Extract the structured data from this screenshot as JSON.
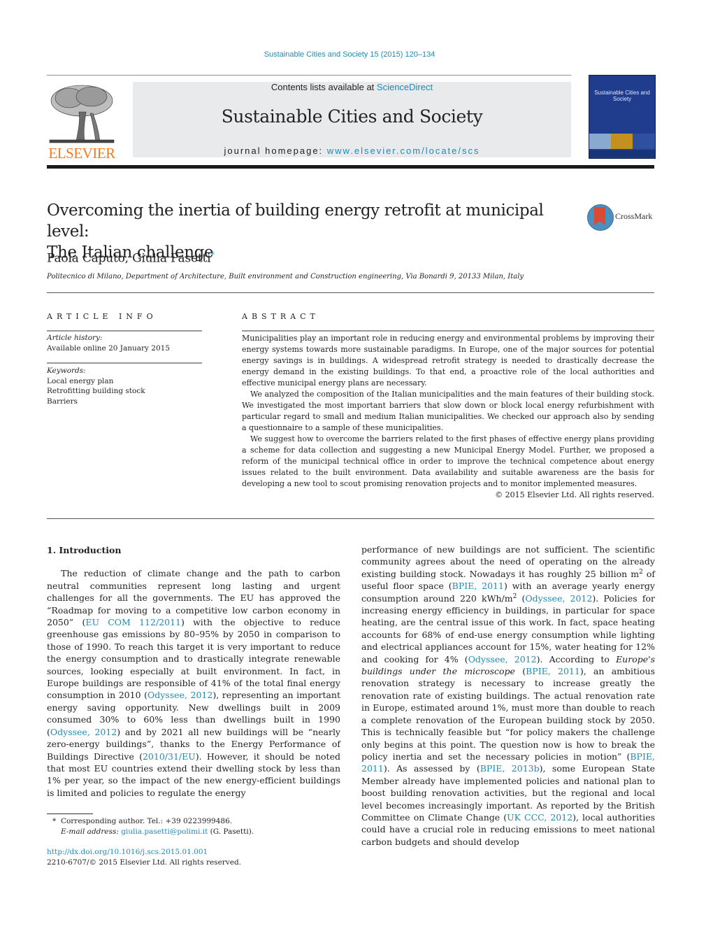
{
  "header": {
    "journal_reference": "Sustainable Cities and Society 15 (2015) 120–134",
    "contents_prefix": "Contents lists available at ",
    "contents_link": "ScienceDirect",
    "journal_title": "Sustainable Cities and Society",
    "homepage_prefix": "journal homepage: ",
    "homepage_url": "www.elsevier.com/locate/scs",
    "publisher_logo_text": "ELSEVIER",
    "cover_title": "Sustainable Cities and Society",
    "logo_icon": "elsevier-tree-icon",
    "cover_icon": "journal-cover-icon"
  },
  "article": {
    "title_line1": "Overcoming the inertia of building energy retrofit at municipal level:",
    "title_line2": "The Italian challenge",
    "crossmark_label": "CrossMark",
    "authors": "Paola Caputo, Giulia Pasetti",
    "corresponding_marker": "*",
    "affiliation": "Politecnico di Milano, Department of Architecture, Built environment and Construction engineering, Via Bonardi 9, 20133 Milan, Italy"
  },
  "article_info": {
    "heading": "ARTICLE INFO",
    "history_label": "Article history:",
    "history_value": "Available online 20 January 2015",
    "keywords_label": "Keywords:",
    "keywords": [
      "Local energy plan",
      "Retrofitting building stock",
      "Barriers"
    ]
  },
  "abstract": {
    "heading": "ABSTRACT",
    "paragraphs": [
      "Municipalities play an important role in reducing energy and environmental problems by improving their energy systems towards more sustainable paradigms. In Europe, one of the major sources for potential energy savings is in buildings. A widespread retrofit strategy is needed to drastically decrease the energy demand in the existing buildings. To that end, a proactive role of the local authorities and effective municipal energy plans are necessary.",
      "We analyzed the composition of the Italian municipalities and the main features of their building stock. We investigated the most important barriers that slow down or block local energy refurbishment with particular regard to small and medium Italian municipalities. We checked our approach also by sending a questionnaire to a sample of these municipalities.",
      "We suggest how to overcome the barriers related to the first phases of effective energy plans providing a scheme for data collection and suggesting a new Municipal Energy Model. Further, we proposed a reform of the municipal technical office in order to improve the technical competence about energy issues related to the built environment. Data availability and suitable awareness are the basis for developing a new tool to scout promising renovation projects and to monitor implemented measures."
    ],
    "copyright": "© 2015 Elsevier Ltd. All rights reserved."
  },
  "body": {
    "section_title": "1.  Introduction",
    "left": {
      "t1": "The reduction of climate change and the path to carbon neutral communities represent long lasting and urgent challenges for all the governments. The EU has approved the “Roadmap for moving to a competitive low carbon economy in 2050” (",
      "l1": "EU COM 112/2011",
      "t2": ") with the objective to reduce greenhouse gas emissions by 80–95% by 2050 in comparison to those of 1990. To reach this target it is very important to reduce the energy consumption and to drastically integrate renewable sources, looking especially at built environment. In fact, in Europe buildings are responsible of 41% of the total final energy consumption in 2010 (",
      "l2": "Odyssee, 2012",
      "t3": "), representing an important energy saving opportunity. New dwellings built in 2009 consumed 30% to 60% less than dwellings built in 1990 (",
      "l3": "Odyssee, 2012",
      "t4": ") and by 2021 all new buildings will be “nearly zero-energy buildings”, thanks to the Energy Performance of Buildings Directive (",
      "l4": "2010/31/EU",
      "t5": "). However, it should be noted that most EU countries extend their dwelling stock by less than 1% per year, so the impact of the new energy-efficient buildings is limited and policies to regulate the energy"
    },
    "right": {
      "t1": "performance of new buildings are not sufficient. The scientific community agrees about the need of operating on the already existing building stock. Nowadays it has roughly 25 billion m",
      "sup1": "2",
      "t2": " of useful floor space (",
      "l1": "BPIE, 2011",
      "t3": ") with an average yearly energy consumption around 220 kWh/m",
      "sup2": "2",
      "t4": " (",
      "l2": "Odyssee, 2012",
      "t5": "). Policies for increasing energy efficiency in buildings, in particular for space heating, are the central issue of this work. In fact, space heating accounts for 68% of end-use energy consumption while lighting and electrical appliances account for 15%, water heating for 12% and cooking for 4% (",
      "l3": "Odyssee, 2012",
      "t6": "). According to ",
      "em1": "Europe's buildings under the microscope",
      "t7": " (",
      "l4": "BPIE, 2011",
      "t8": "), an ambitious renovation strategy is necessary to increase greatly the renovation rate of existing buildings. The actual renovation rate in Europe, estimated around 1%, must more than double to reach a complete renovation of the European building stock by 2050. This is technically feasible but “for policy makers the challenge only begins at this point. The question now is how to break the policy inertia and set the necessary policies in motion” (",
      "l5": "BPIE, 2011",
      "t9": "). As assessed by (",
      "l6": "BPIE, 2013b",
      "t10": "), some European State Member already have implemented policies and national plan to boost building renovation activities, but the regional and local level becomes increasingly important. As reported by the British Committee on Climate Change (",
      "l7": "UK CCC, 2012",
      "t11": "), local authorities could have a crucial role in reducing emissions to meet national carbon budgets and should develop"
    }
  },
  "footnote": {
    "marker": "*",
    "corresponding": "Corresponding author. Tel.: +39 0223999486.",
    "email_label": "E-mail address: ",
    "email": "giulia.pasetti@polimi.it",
    "email_suffix": " (G. Pasetti).",
    "doi": "http://dx.doi.org/10.1016/j.scs.2015.01.001",
    "issn_copyright": "2210-6707/© 2015 Elsevier Ltd. All rights reserved."
  },
  "colors": {
    "link": "#1f8bb5",
    "elsevier_orange": "#f47a20",
    "banner_gray": "#e9eaeb",
    "cover_blue": "#1f3d8c"
  }
}
